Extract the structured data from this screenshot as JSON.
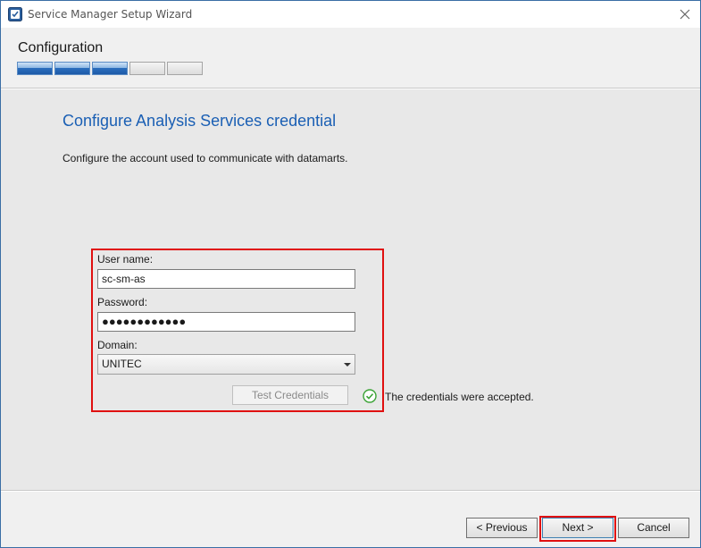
{
  "window": {
    "title": "Service Manager Setup Wizard"
  },
  "header": {
    "step_title": "Configuration",
    "progress": {
      "completed_steps": 3,
      "total_steps": 5
    }
  },
  "main": {
    "heading": "Configure Analysis Services credential",
    "description": "Configure the account used to communicate with datamarts.",
    "username_label": "User name:",
    "username_value": "sc-sm-as",
    "password_label": "Password:",
    "password_value": "●●●●●●●●●●●●",
    "domain_label": "Domain:",
    "domain_value": "UNITEC",
    "test_button": "Test Credentials",
    "status_text": "The credentials were accepted.",
    "status_icon": "check-circle-icon",
    "status_color": "#3aa335"
  },
  "footer": {
    "previous_label": "< Previous",
    "next_label": "Next >",
    "cancel_label": "Cancel"
  },
  "colors": {
    "heading": "#1a5fb4",
    "highlight": "#e01010",
    "progress_fill": "#1d5aa8"
  }
}
